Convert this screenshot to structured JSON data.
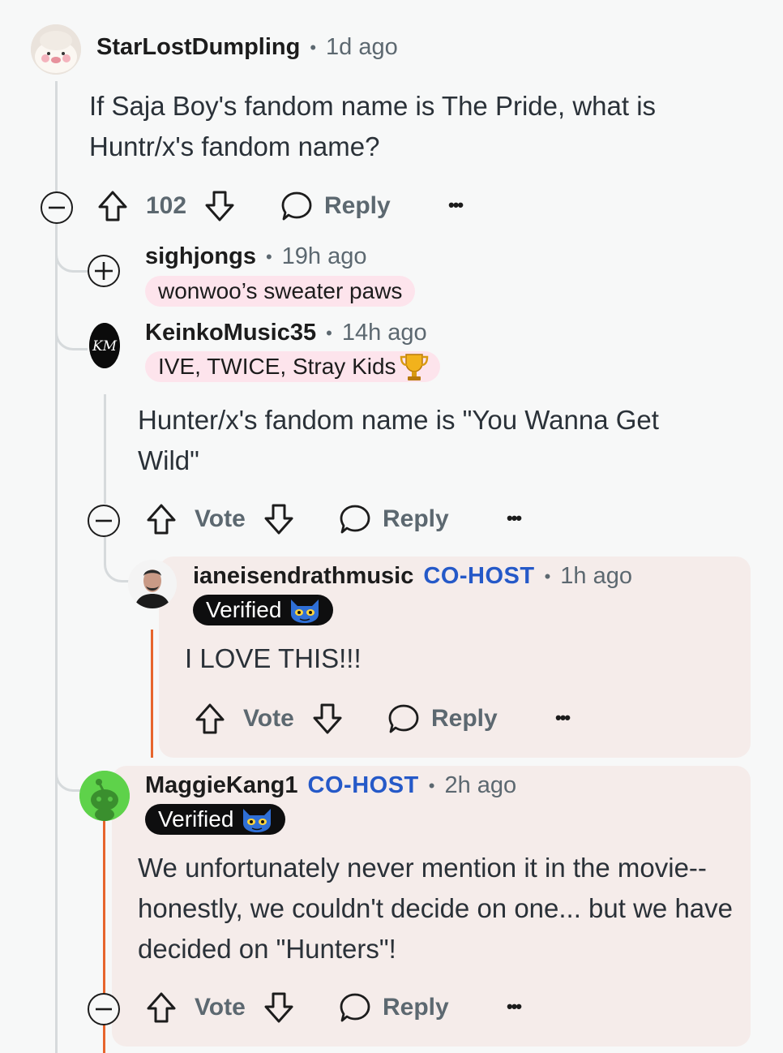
{
  "post": {
    "username": "StarLostDumpling",
    "time": "1d ago",
    "text": "If Saja Boy's fandom name is The Pride, what is Huntr/x's fandom name?",
    "score": "102",
    "reply_label": "Reply"
  },
  "collapsed_reply": {
    "username": "sighjongs",
    "time": "19h ago",
    "flair": "wonwoo’s sweater paws"
  },
  "reply1": {
    "username": "KeinkoMusic35",
    "time": "14h ago",
    "flair": "IVE, TWICE, Stray Kids",
    "avatar_text": "KM",
    "text": "Hunter/x's fandom name is \"You Wanna Get Wild\"",
    "vote_label": "Vote",
    "reply_label": "Reply"
  },
  "reply2": {
    "username": "ianeisendrathmusic",
    "role": "CO-HOST",
    "time": "1h ago",
    "verified": "Verified",
    "text": "I LOVE THIS!!!",
    "vote_label": "Vote",
    "reply_label": "Reply"
  },
  "reply3": {
    "username": "MaggieKang1",
    "role": "CO-HOST",
    "time": "2h ago",
    "verified": "Verified",
    "text": "We unfortunately never mention it in the movie-- honestly, we couldn't decide on one... but we have decided on \"Hunters\"!",
    "vote_label": "Vote",
    "reply_label": "Reply"
  },
  "colors": {
    "accent_blue": "#2559c8",
    "mod_orange": "#e7652d",
    "flair_pink": "#fde4ec",
    "highlight_bg": "#f5ecea",
    "meta_gray": "#5c6870"
  },
  "separator": "•",
  "more_glyph": "•••"
}
